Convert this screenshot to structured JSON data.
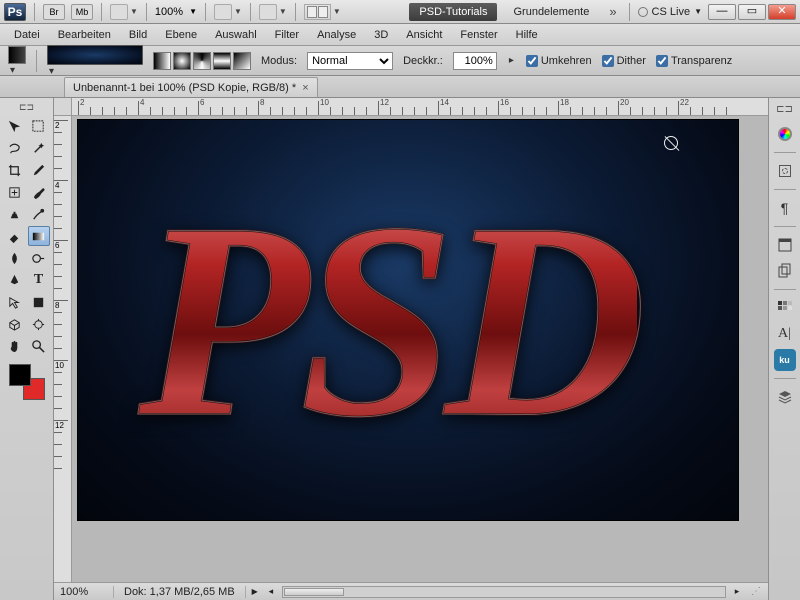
{
  "appbar": {
    "ps_label": "Ps",
    "badges": [
      "Br",
      "Mb"
    ],
    "zoom": "100%",
    "workspaces": [
      "PSD-Tutorials",
      "Grundelemente"
    ],
    "cslive": "CS Live"
  },
  "menu": [
    "Datei",
    "Bearbeiten",
    "Bild",
    "Ebene",
    "Auswahl",
    "Filter",
    "Analyse",
    "3D",
    "Ansicht",
    "Fenster",
    "Hilfe"
  ],
  "options": {
    "mode_label": "Modus:",
    "mode_value": "Normal",
    "opacity_label": "Deckkr.:",
    "opacity_value": "100%",
    "reverse_label": "Umkehren",
    "dither_label": "Dither",
    "transparency_label": "Transparenz"
  },
  "doc_tab": "Unbenannt-1 bei 100% (PSD Kopie, RGB/8) *",
  "canvas": {
    "text": "PSD"
  },
  "ruler_h": [
    "2",
    "4",
    "6",
    "8",
    "10",
    "12",
    "14",
    "16",
    "18",
    "20",
    "22"
  ],
  "ruler_v": [
    "2",
    "4",
    "6",
    "8",
    "10",
    "12"
  ],
  "status": {
    "zoom": "100%",
    "docinfo": "Dok: 1,37 MB/2,65 MB"
  },
  "panels_right": [
    "color",
    "mask",
    "paragraph",
    "history",
    "clone",
    "swatches",
    "character",
    "kuler",
    "layers"
  ]
}
